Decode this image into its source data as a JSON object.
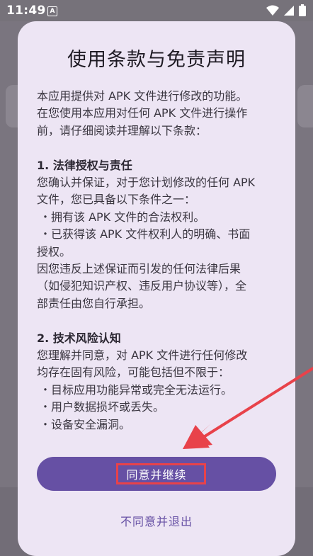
{
  "status_bar": {
    "time": "11:49",
    "notification_glyph": "A",
    "icons": [
      "wifi-icon",
      "signal-icon",
      "battery-icon"
    ]
  },
  "dialog": {
    "title": "使用条款与免责声明",
    "intro": [
      "本应用提供对 APK 文件进行修改的功能。",
      "在您使用本应用对任何 APK 文件进行操作",
      "前，请仔细阅读并理解以下条款："
    ],
    "section1": {
      "heading": "1. 法律授权与责任",
      "lines": [
        "您确认并保证，对于您计划修改的任何 APK",
        "文件，您已具备以下条件之一："
      ],
      "bullets": [
        "・拥有该 APK 文件的合法权利。",
        "・已获得该 APK 文件权利人的明确、书面",
        "授权。"
      ],
      "closing": [
        "因您违反上述保证而引发的任何法律后果",
        "（如侵犯知识产权、违反用户协议等），全",
        "部责任由您自行承担。"
      ]
    },
    "section2": {
      "heading": "2. 技术风险认知",
      "lines": [
        "您理解并同意，对 APK 文件进行任何修改",
        "均存在固有风险，可能包括但不限于："
      ],
      "bullets": [
        "・目标应用功能异常或完全无法运行。",
        "・用户数据损坏或丢失。",
        "・设备安全漏洞。"
      ]
    },
    "agree_label": "同意并继续",
    "decline_label": "不同意并退出"
  },
  "colors": {
    "primary": "#6650a4",
    "dialog_bg": "#ede5f4",
    "annotation": "#e8424a"
  }
}
